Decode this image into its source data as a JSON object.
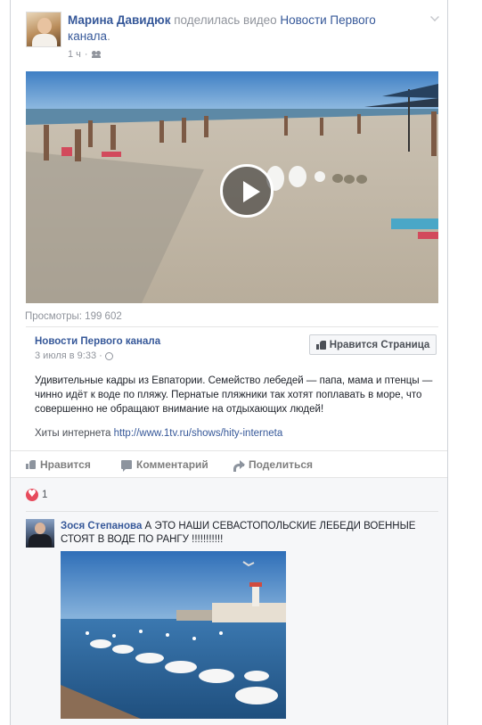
{
  "post": {
    "author": "Марина Давидюк",
    "action_text": "поделилась видео",
    "page_name": "Новости Первого канала",
    "page_suffix": ".",
    "time": "1 ч"
  },
  "video": {
    "views": "Просмотры: 199 602"
  },
  "shared": {
    "title": "Новости Первого канала",
    "date": "3 июля в 9:33",
    "like_page_label": "Нравится Страница",
    "description": "Удивительные кадры из Евпатории. Семейство лебедей — папа, мама и птенцы — чинно идёт к воде по пляжу. Пернатые пляжники так хотят поплавать в море, что совершенно не обращают внимание на отдыхающих людей!",
    "link_prefix": "Хиты интернета",
    "link_url": "http://www.1tv.ru/shows/hity-interneta"
  },
  "actions": {
    "like": "Нравится",
    "comment": "Комментарий",
    "share": "Поделиться"
  },
  "reactions": {
    "count": "1"
  },
  "comment": {
    "author": "Зося Степанова",
    "text": "А ЭТО НАШИ СЕВАСТОПОЛЬСКИЕ ЛЕБЕДИ ВОЕННЫЕ СТОЯТ В ВОДЕ ПО РАНГУ !!!!!!!!!!!"
  },
  "colors": {
    "link_blue": "#365899",
    "meta_gray": "#90949c",
    "heart_red": "#e74b5c"
  }
}
